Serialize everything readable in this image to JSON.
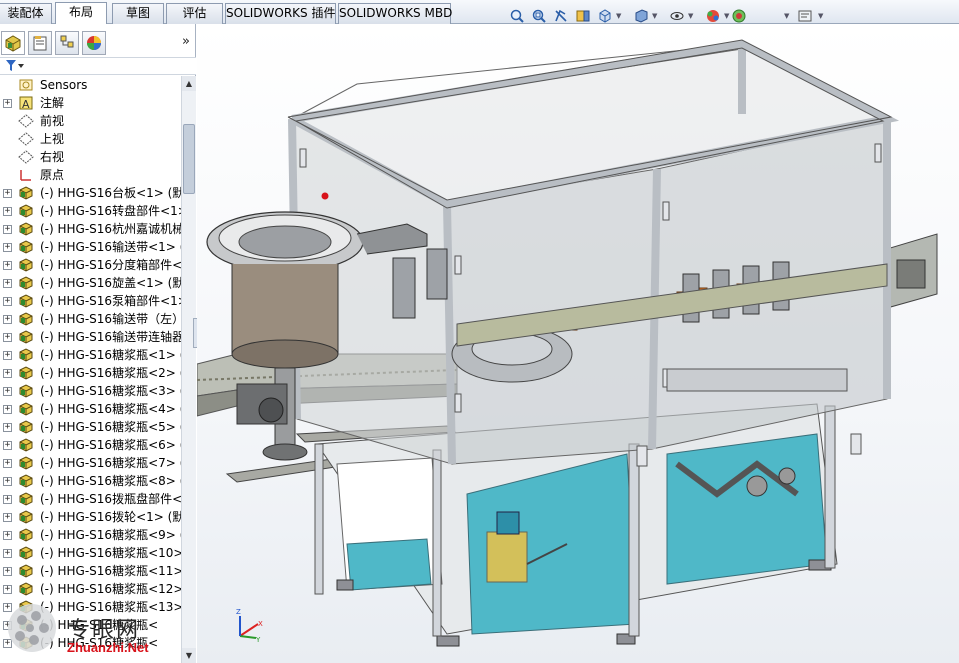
{
  "tabs": [
    {
      "label": "装配体",
      "active": false
    },
    {
      "label": "布局",
      "active": true
    },
    {
      "label": "草图",
      "active": false
    },
    {
      "label": "评估",
      "active": false
    },
    {
      "label": "SOLIDWORKS 插件",
      "active": false
    },
    {
      "label": "SOLIDWORKS MBD",
      "active": false
    }
  ],
  "view_toolbar": [
    "zoom-to-fit-icon",
    "zoom-to-area-icon",
    "previous-view-icon",
    "section-view-icon",
    "view-orientation-icon",
    "display-style-icon",
    "hide-show-items-icon",
    "edit-appearance-icon",
    "apply-scene-icon",
    "view-settings-icon"
  ],
  "panel_tabs": [
    "feature-manager-icon",
    "property-manager-icon",
    "configuration-manager-icon",
    "display-manager-icon"
  ],
  "collapse_label": "»",
  "tree": [
    {
      "label": "Sensors",
      "icon": "sensors-icon",
      "expander": ""
    },
    {
      "label": "注解",
      "icon": "annotations-icon",
      "expander": "+"
    },
    {
      "label": "前视",
      "icon": "plane-icon",
      "expander": ""
    },
    {
      "label": "上视",
      "icon": "plane-icon",
      "expander": ""
    },
    {
      "label": "右视",
      "icon": "plane-icon",
      "expander": ""
    },
    {
      "label": "原点",
      "icon": "origin-icon",
      "expander": ""
    },
    {
      "label": "(-) HHG-S16台板<1> (默",
      "icon": "subassembly-icon",
      "expander": "+"
    },
    {
      "label": "(-) HHG-S16转盘部件<1>",
      "icon": "subassembly-icon",
      "expander": "+"
    },
    {
      "label": "(-) HHG-S16杭州嘉诚机械",
      "icon": "subassembly-icon",
      "expander": "+"
    },
    {
      "label": "(-) HHG-S16输送带<1> (",
      "icon": "subassembly-icon",
      "expander": "+"
    },
    {
      "label": "(-) HHG-S16分度箱部件<",
      "icon": "subassembly-icon",
      "expander": "+"
    },
    {
      "label": "(-) HHG-S16旋盖<1> (默",
      "icon": "subassembly-icon",
      "expander": "+"
    },
    {
      "label": "(-) HHG-S16泵箱部件<1>",
      "icon": "subassembly-icon",
      "expander": "+"
    },
    {
      "label": "(-) HHG-S16输送带（左）",
      "icon": "subassembly-icon",
      "expander": "+"
    },
    {
      "label": "(-) HHG-S16输送带连轴器",
      "icon": "subassembly-icon",
      "expander": "+"
    },
    {
      "label": "(-) HHG-S16糖浆瓶<1> (",
      "icon": "subassembly-icon",
      "expander": "+"
    },
    {
      "label": "(-) HHG-S16糖浆瓶<2> (",
      "icon": "subassembly-icon",
      "expander": "+"
    },
    {
      "label": "(-) HHG-S16糖浆瓶<3> (",
      "icon": "subassembly-icon",
      "expander": "+"
    },
    {
      "label": "(-) HHG-S16糖浆瓶<4> (",
      "icon": "subassembly-icon",
      "expander": "+"
    },
    {
      "label": "(-) HHG-S16糖浆瓶<5> (",
      "icon": "subassembly-icon",
      "expander": "+"
    },
    {
      "label": "(-) HHG-S16糖浆瓶<6> (",
      "icon": "subassembly-icon",
      "expander": "+"
    },
    {
      "label": "(-) HHG-S16糖浆瓶<7> (",
      "icon": "subassembly-icon",
      "expander": "+"
    },
    {
      "label": "(-) HHG-S16糖浆瓶<8> (",
      "icon": "subassembly-icon",
      "expander": "+"
    },
    {
      "label": "(-) HHG-S16拨瓶盘部件<",
      "icon": "subassembly-icon",
      "expander": "+"
    },
    {
      "label": "(-) HHG-S16拨轮<1> (默",
      "icon": "subassembly-icon",
      "expander": "+"
    },
    {
      "label": "(-) HHG-S16糖浆瓶<9> (",
      "icon": "subassembly-icon",
      "expander": "+"
    },
    {
      "label": "(-) HHG-S16糖浆瓶<10>",
      "icon": "subassembly-icon",
      "expander": "+"
    },
    {
      "label": "(-) HHG-S16糖浆瓶<11>",
      "icon": "subassembly-icon",
      "expander": "+"
    },
    {
      "label": "(-) HHG-S16糖浆瓶<12>",
      "icon": "subassembly-icon",
      "expander": "+"
    },
    {
      "label": "(-) HHG-S16糖浆瓶<13>",
      "icon": "subassembly-icon",
      "expander": "+"
    },
    {
      "label": "(-) HHG-S16糖浆瓶<",
      "icon": "subassembly-icon",
      "expander": "+"
    },
    {
      "label": "(-) HHG-S16糖浆瓶<",
      "icon": "subassembly-icon",
      "expander": "+"
    }
  ],
  "triad": {
    "x": "X",
    "y": "Y",
    "z": "Z"
  },
  "watermark": {
    "text": "专眼网",
    "url": "Zhuanzhi.Net"
  },
  "colors": {
    "frame": "#d4d8de",
    "glass": "#c8cdd2",
    "base_floor": "#4fb8c8",
    "motor_orange": "#e07a28",
    "accent_red": "#d8121a"
  }
}
